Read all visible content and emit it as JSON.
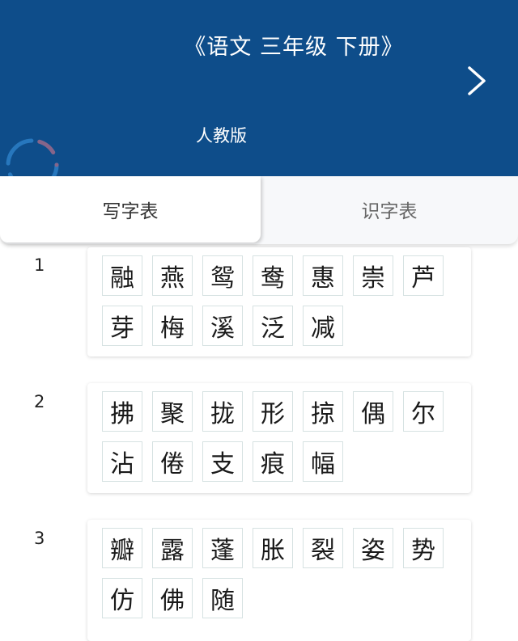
{
  "header": {
    "title": "《语文 三年级 下册》",
    "edition": "人教版"
  },
  "tabs": [
    {
      "label": "写字表",
      "active": true
    },
    {
      "label": "识字表",
      "active": false
    }
  ],
  "colors": {
    "header_bg": "#0e4d8a",
    "card_bg": "#ffffff"
  },
  "lessons": [
    {
      "number": "1",
      "chars": [
        "融",
        "燕",
        "鸳",
        "鸯",
        "惠",
        "崇",
        "芦",
        "芽",
        "梅",
        "溪",
        "泛",
        "减"
      ]
    },
    {
      "number": "2",
      "chars": [
        "拂",
        "聚",
        "拢",
        "形",
        "掠",
        "偶",
        "尔",
        "沾",
        "倦",
        "支",
        "痕",
        "幅"
      ]
    },
    {
      "number": "3",
      "chars": [
        "瓣",
        "露",
        "蓬",
        "胀",
        "裂",
        "姿",
        "势",
        "仿",
        "佛",
        "随"
      ]
    }
  ]
}
